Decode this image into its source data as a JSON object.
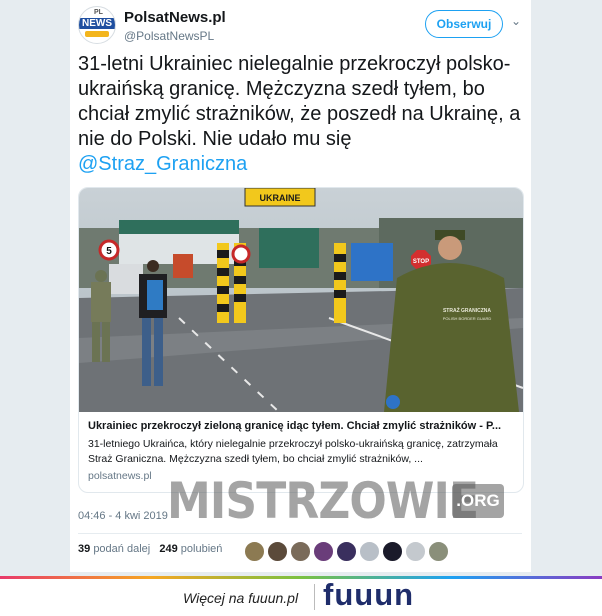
{
  "account": {
    "name": "PolsatNews.pl",
    "handle": "@PolsatNewsPL",
    "avatar_pl": "PL",
    "avatar_news": "NEWS"
  },
  "follow_label": "Obserwuj",
  "tweet": {
    "text": "31-letni Ukrainiec nielegalnie przekroczył polsko-ukraińską granicę. Mężczyzna szedł tyłem, bo chciał zmylić strażników, że poszedł na Ukrainę, a nie do Polski. Nie udało mu się",
    "mention": "@Straz_Graniczna"
  },
  "card": {
    "image_sign": "UKRAINE",
    "guard_patch_line1": "STRAŻ GRANICZNA",
    "guard_patch_line2": "POLISH BORDER GUARD",
    "stop_sign": "STOP",
    "speed_limit": "5",
    "title": "Ukrainiec przekroczył zieloną granicę idąc tyłem. Chciał zmylić strażników - P...",
    "description": "31-letniego Ukraińca, który nielegalnie przekroczył polsko-ukraińską granicę, zatrzymała Straż Graniczna. Mężczyzna szedł tyłem, bo chciał zmylić strażników, ...",
    "url": "polsatnews.pl"
  },
  "timestamp": "04:46 - 4 kwi 2019",
  "watermark": {
    "main": "MISTRZOWIE",
    "suffix": ".ORG"
  },
  "stats": {
    "retweets": "39",
    "retweets_label": "podań dalej",
    "likes": "249",
    "likes_label": "polubień"
  },
  "footer": {
    "more_text": "Więcej na fuuun.pl",
    "logo": "fuuun"
  },
  "colors": {
    "link": "#1da1f2",
    "text": "#14171a",
    "muted": "#657786",
    "logo": "#1f2d6b"
  }
}
